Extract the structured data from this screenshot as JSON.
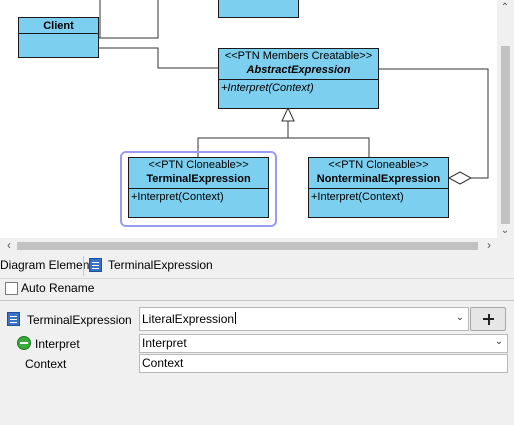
{
  "diagram": {
    "classes": [
      {
        "id": "client",
        "name": "Client",
        "stereotype": "",
        "ops": []
      },
      {
        "id": "abstract_expression",
        "name": "AbstractExpression",
        "stereotype": "<<PTN Members Creatable>>",
        "ops": [
          "+Interpret(Context)"
        ]
      },
      {
        "id": "terminal_expression",
        "name": "TerminalExpression",
        "stereotype": "<<PTN Cloneable>>",
        "ops": [
          "+Interpret(Context)"
        ]
      },
      {
        "id": "nonterminal_expression",
        "name": "NonterminalExpression",
        "stereotype": "<<PTN Cloneable>>",
        "ops": [
          "+Interpret(Context)"
        ]
      }
    ]
  },
  "tabs": {
    "diagram_element": "Diagram Element",
    "selected_element": "TerminalExpression"
  },
  "auto_rename": {
    "label": "Auto Rename",
    "checked": false
  },
  "properties": {
    "class_name_label": "TerminalExpression",
    "class_name_value": "LiteralExpression",
    "operation_label": "Interpret",
    "operation_value": "Interpret",
    "parameter_label": "Context",
    "parameter_value": "Context"
  },
  "icons": {
    "scroll_up": "chevron-up-icon",
    "scroll_down": "chevron-down-icon",
    "scroll_left": "chevron-left-icon",
    "scroll_right": "chevron-right-icon",
    "add": "plus-icon",
    "class": "class-icon",
    "operation": "operation-icon",
    "dropdown": "chevron-down-icon"
  },
  "colors": {
    "class_fill": "#7ccfef",
    "selection": "#9a9cf0"
  }
}
